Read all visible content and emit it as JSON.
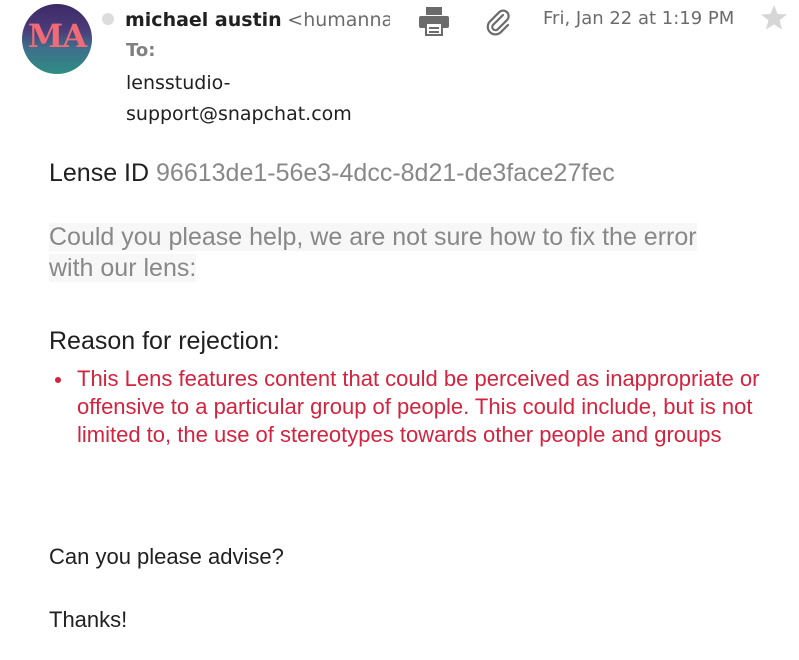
{
  "header": {
    "avatar_initials": "MA",
    "sender_name": "michael austin",
    "sender_email": "<humanna",
    "to_label": "To:",
    "recipient_line1": "lensstudio-",
    "recipient_line2": "support@snapchat.com",
    "date": "Fri, Jan 22 at 1:19 PM",
    "icons": [
      "print-icon",
      "attachment-icon",
      "star-icon"
    ]
  },
  "body": {
    "lens_label": "Lense ID",
    "lens_id": "96613de1-56e3-4dcc-8d21-de3face27fec",
    "question": "Could you please help, we are not sure how to fix the error with our lens:",
    "reason_title": "Reason for rejection:",
    "reasons": [
      "This Lens features content that could be perceived as inappropriate or offensive to a particular group of people. This could include, but is not limited to, the use of stereotypes towards other people and groups"
    ],
    "advise": "Can you please advise?",
    "thanks": "Thanks!"
  },
  "colors": {
    "text": "#202020",
    "muted": "#888888",
    "rejection_red": "#d2233f",
    "avatar_initials": "#ee6b77"
  }
}
